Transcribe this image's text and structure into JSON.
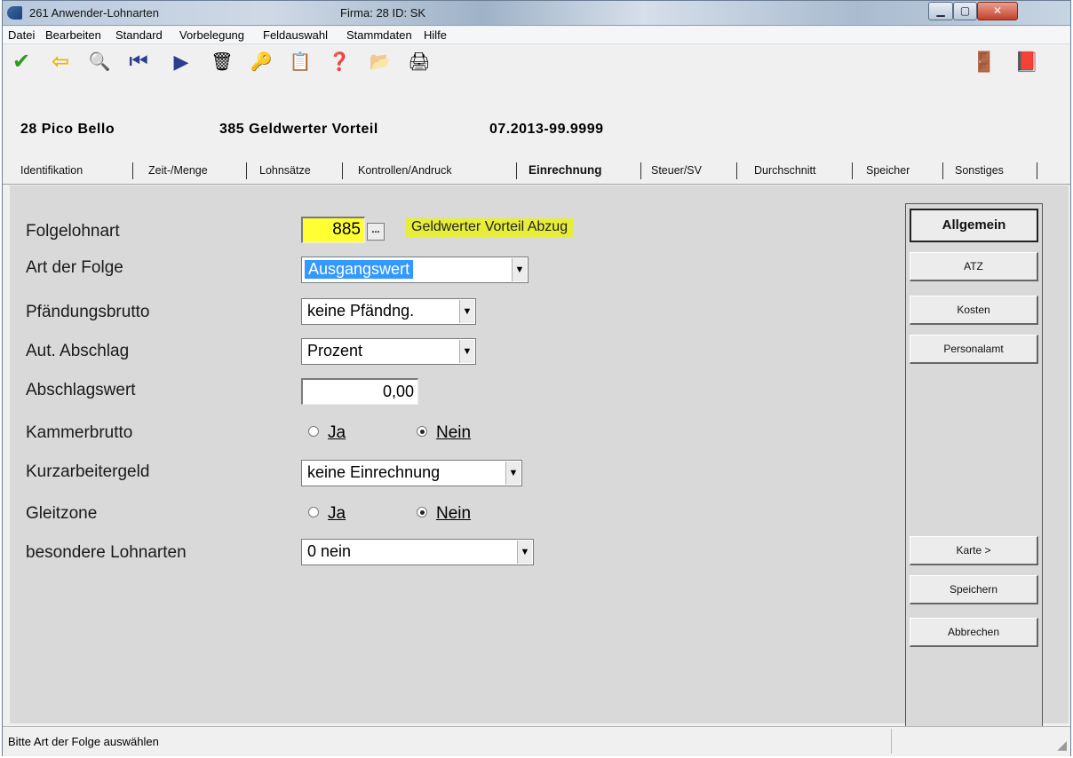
{
  "window": {
    "title": "261 Anwender-Lohnarten",
    "firma_label": "Firma: 28   ID: SK",
    "min_glyph": "▁",
    "max_glyph": "▢",
    "close_glyph": "✕"
  },
  "menu": [
    "Datei",
    "Bearbeiten",
    "Standard",
    "Vorbelegung",
    "Feldauswahl",
    "Stammdaten",
    "Hilfe"
  ],
  "toolbar": {
    "ok_icon": "✔",
    "back_icon": "⇦",
    "search_icon": "🔍",
    "first_icon": "⏮",
    "next_icon": "▶",
    "delete_icon": "🗑",
    "key_icon": "🔑",
    "export_icon": "📋",
    "help_icon": "❓",
    "folder_icon": "📂",
    "print_icon": "🖨",
    "exit_icon": "🚪",
    "book_icon": "📕"
  },
  "header": {
    "company": "28 Pico Bello",
    "wage_type": "385 Geldwerter Vorteil",
    "period": "07.2013-99.9999"
  },
  "tabs": [
    "Identifikation",
    "Zeit-/Menge",
    "Lohnsätze",
    "Kontrollen/Andruck",
    "Einrechnung",
    "Steuer/SV",
    "Durchschnitt",
    "Speicher",
    "Sonstiges"
  ],
  "form": {
    "folgelohnart": {
      "label": "Folgelohnart",
      "value": "885",
      "browse": "...",
      "description": "Geldwerter Vorteil Abzug"
    },
    "art_der_folge": {
      "label": "Art der Folge",
      "value": "Ausgangswert"
    },
    "pfaendungsbrutto": {
      "label": "Pfändungsbrutto",
      "value": "keine Pfändng."
    },
    "aut_abschlag": {
      "label": "Aut. Abschlag",
      "value": "Prozent"
    },
    "abschlagswert": {
      "label": "Abschlagswert",
      "value": "0,00"
    },
    "kammerbrutto": {
      "label": "Kammerbrutto",
      "yes": "Ja",
      "no": "Nein",
      "selected": "Nein"
    },
    "kurzarbeitergeld": {
      "label": "Kurzarbeitergeld",
      "value": "keine Einrechnung"
    },
    "gleitzone": {
      "label": "Gleitzone",
      "yes": "Ja",
      "no": "Nein",
      "selected": "Nein"
    },
    "besondere_lohnarten": {
      "label": "besondere Lohnarten",
      "value": "0 nein"
    }
  },
  "side_buttons": {
    "allgemein": "Allgemein",
    "atz": "ATZ",
    "kosten": "Kosten",
    "personalamt": "Personalamt",
    "karte": "Karte >",
    "speichern": "Speichern",
    "abbrechen": "Abbrechen"
  },
  "status": {
    "text": "Bitte Art der Folge auswählen"
  },
  "colors": {
    "highlight": "#ffff33",
    "selection": "#3399ff",
    "ok_green": "#2e9a1e",
    "panel": "#d9d9d9"
  }
}
